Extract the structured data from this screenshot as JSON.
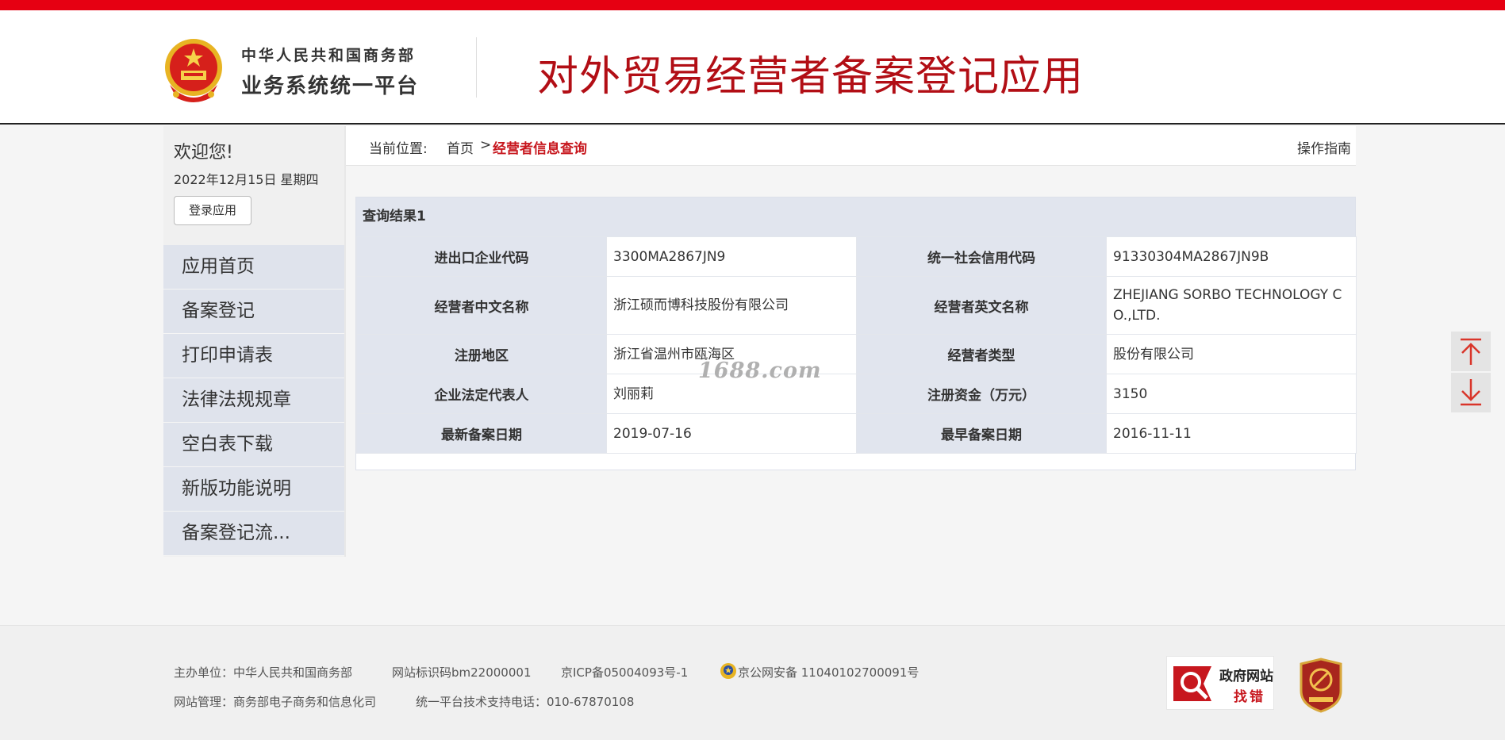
{
  "header": {
    "org_line1": "中华人民共和国商务部",
    "org_line2": "业务系统统一平台",
    "app_title": "对外贸易经营者备案登记应用"
  },
  "sidebar": {
    "welcome": "欢迎您!",
    "date": "2022年12月15日 星期四",
    "login_label": "登录应用",
    "menu": [
      {
        "label": "应用首页"
      },
      {
        "label": "备案登记"
      },
      {
        "label": "打印申请表"
      },
      {
        "label": "法律法规规章"
      },
      {
        "label": "空白表下载"
      },
      {
        "label": "新版功能说明"
      },
      {
        "label": "备案登记流..."
      }
    ]
  },
  "breadcrumb": {
    "label": "当前位置:",
    "home": "首页",
    "separator": ">",
    "current": "经营者信息查询",
    "guide": "操作指南"
  },
  "result": {
    "title": "查询结果1",
    "rows": [
      {
        "l1": "进出口企业代码",
        "v1": "3300MA2867JN9",
        "l2": "统一社会信用代码",
        "v2": "91330304MA2867JN9B"
      },
      {
        "l1": "经营者中文名称",
        "v1": "浙江硕而博科技股份有限公司",
        "l2": "经营者英文名称",
        "v2": "ZHEJIANG SORBO TECHNOLOGY CO.,LTD."
      },
      {
        "l1": "注册地区",
        "v1": "浙江省温州市瓯海区",
        "l2": "经营者类型",
        "v2": "股份有限公司"
      },
      {
        "l1": "企业法定代表人",
        "v1": "刘丽莉",
        "l2": "注册资金（万元）",
        "v2": "3150"
      },
      {
        "l1": "最新备案日期",
        "v1": "2019-07-16",
        "l2": "最早备案日期",
        "v2": "2016-11-11"
      }
    ]
  },
  "watermark": "1688.com",
  "footer": {
    "sponsor": "主办单位：中华人民共和国商务部",
    "site_code": "网站标识码bm22000001",
    "icp": "京ICP备05004093号-1",
    "police": "京公网安备 11040102700091号",
    "manager": "网站管理：商务部电子商务和信息化司",
    "support": "统一平台技术支持电话：010-67870108",
    "gov_badge_line1": "政府网站",
    "gov_badge_line2": "找错"
  },
  "colors": {
    "top_bar": "#e60012",
    "title_red": "#b20e15",
    "accent_red": "#c7171e",
    "label_bg": "#e1e5ee"
  },
  "icons": [
    "national-emblem-icon",
    "back-to-top-icon",
    "scroll-to-bottom-icon",
    "police-badge-icon",
    "gov-search-icon",
    "party-emblem-icon"
  ]
}
